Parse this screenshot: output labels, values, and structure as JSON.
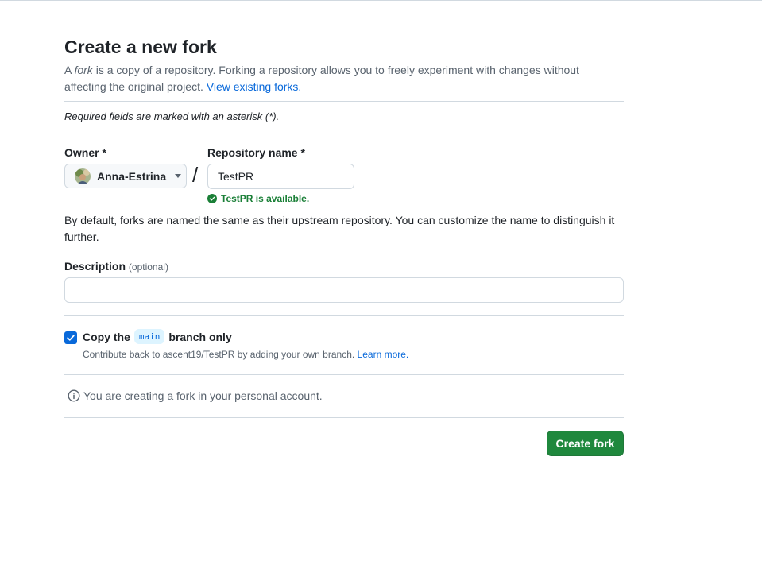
{
  "page": {
    "title": "Create a new fork",
    "intro": {
      "prefix": "A ",
      "fork_word": "fork",
      "text": " is a copy of a repository. Forking a repository allows you to freely experiment with changes without affecting the original project. ",
      "link": "View existing forks."
    },
    "required_note": "Required fields are marked with an asterisk (*)."
  },
  "owner": {
    "label": "Owner *",
    "name": "Anna-Estrina"
  },
  "separator": "/",
  "repository": {
    "label": "Repository name *",
    "value": "TestPR",
    "availability": "TestPR is available."
  },
  "naming_note": "By default, forks are named the same as their upstream repository. You can customize the name to distinguish it further.",
  "description": {
    "label": "Description",
    "optional": "(optional)",
    "value": "",
    "placeholder": ""
  },
  "copy_branch": {
    "checked": true,
    "label_before": "Copy the",
    "branch": "main",
    "label_after": "branch only",
    "sub_text": "Contribute back to ascent19/TestPR by adding your own branch. ",
    "sub_link": "Learn more."
  },
  "info": "You are creating a fork in your personal account.",
  "actions": {
    "create": "Create fork"
  },
  "colors": {
    "primary": "#1f883d",
    "link": "#0969da",
    "success": "#1a7f37"
  },
  "icons": {
    "owner_avatar": "avatar",
    "available": "check-circle-icon",
    "info": "info-icon",
    "checkbox": "check-icon",
    "dropdown": "triangle-down-icon"
  }
}
